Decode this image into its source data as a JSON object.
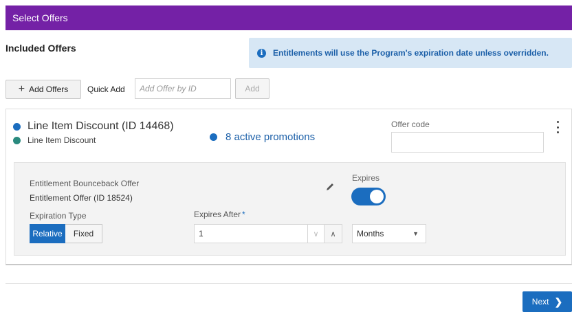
{
  "header": {
    "title": "Select Offers"
  },
  "section": {
    "title": "Included Offers"
  },
  "info": {
    "icon": "info-icon",
    "text": "Entitlements will use the Program's expiration date unless overridden."
  },
  "toolbar": {
    "add_offers_label": "Add Offers",
    "quick_add_label": "Quick Add",
    "quick_add_placeholder": "Add Offer by ID",
    "add_label": "Add"
  },
  "offer": {
    "title": "Line Item Discount (ID 14468)",
    "subtitle": "Line Item Discount",
    "promotions": "8 active promotions",
    "offer_code_label": "Offer code",
    "offer_code_value": "",
    "entitlement_label": "Entitlement Bounceback Offer",
    "entitlement_value": "Entitlement Offer (ID 18524)",
    "expires_label": "Expires",
    "expires_on": true,
    "expiration_type_label": "Expiration Type",
    "expiration_type_options": [
      "Relative",
      "Fixed"
    ],
    "expiration_type_selected": "Relative",
    "expires_after_label": "Expires After",
    "expires_after_required": "*",
    "expires_after_value": "1",
    "unit_selected": "Months"
  },
  "footer": {
    "next_label": "Next"
  },
  "colors": {
    "header": "#7421a6",
    "accent": "#1b6dbf",
    "info_bg": "#d7e7f5",
    "teal": "#2a8a7e"
  }
}
